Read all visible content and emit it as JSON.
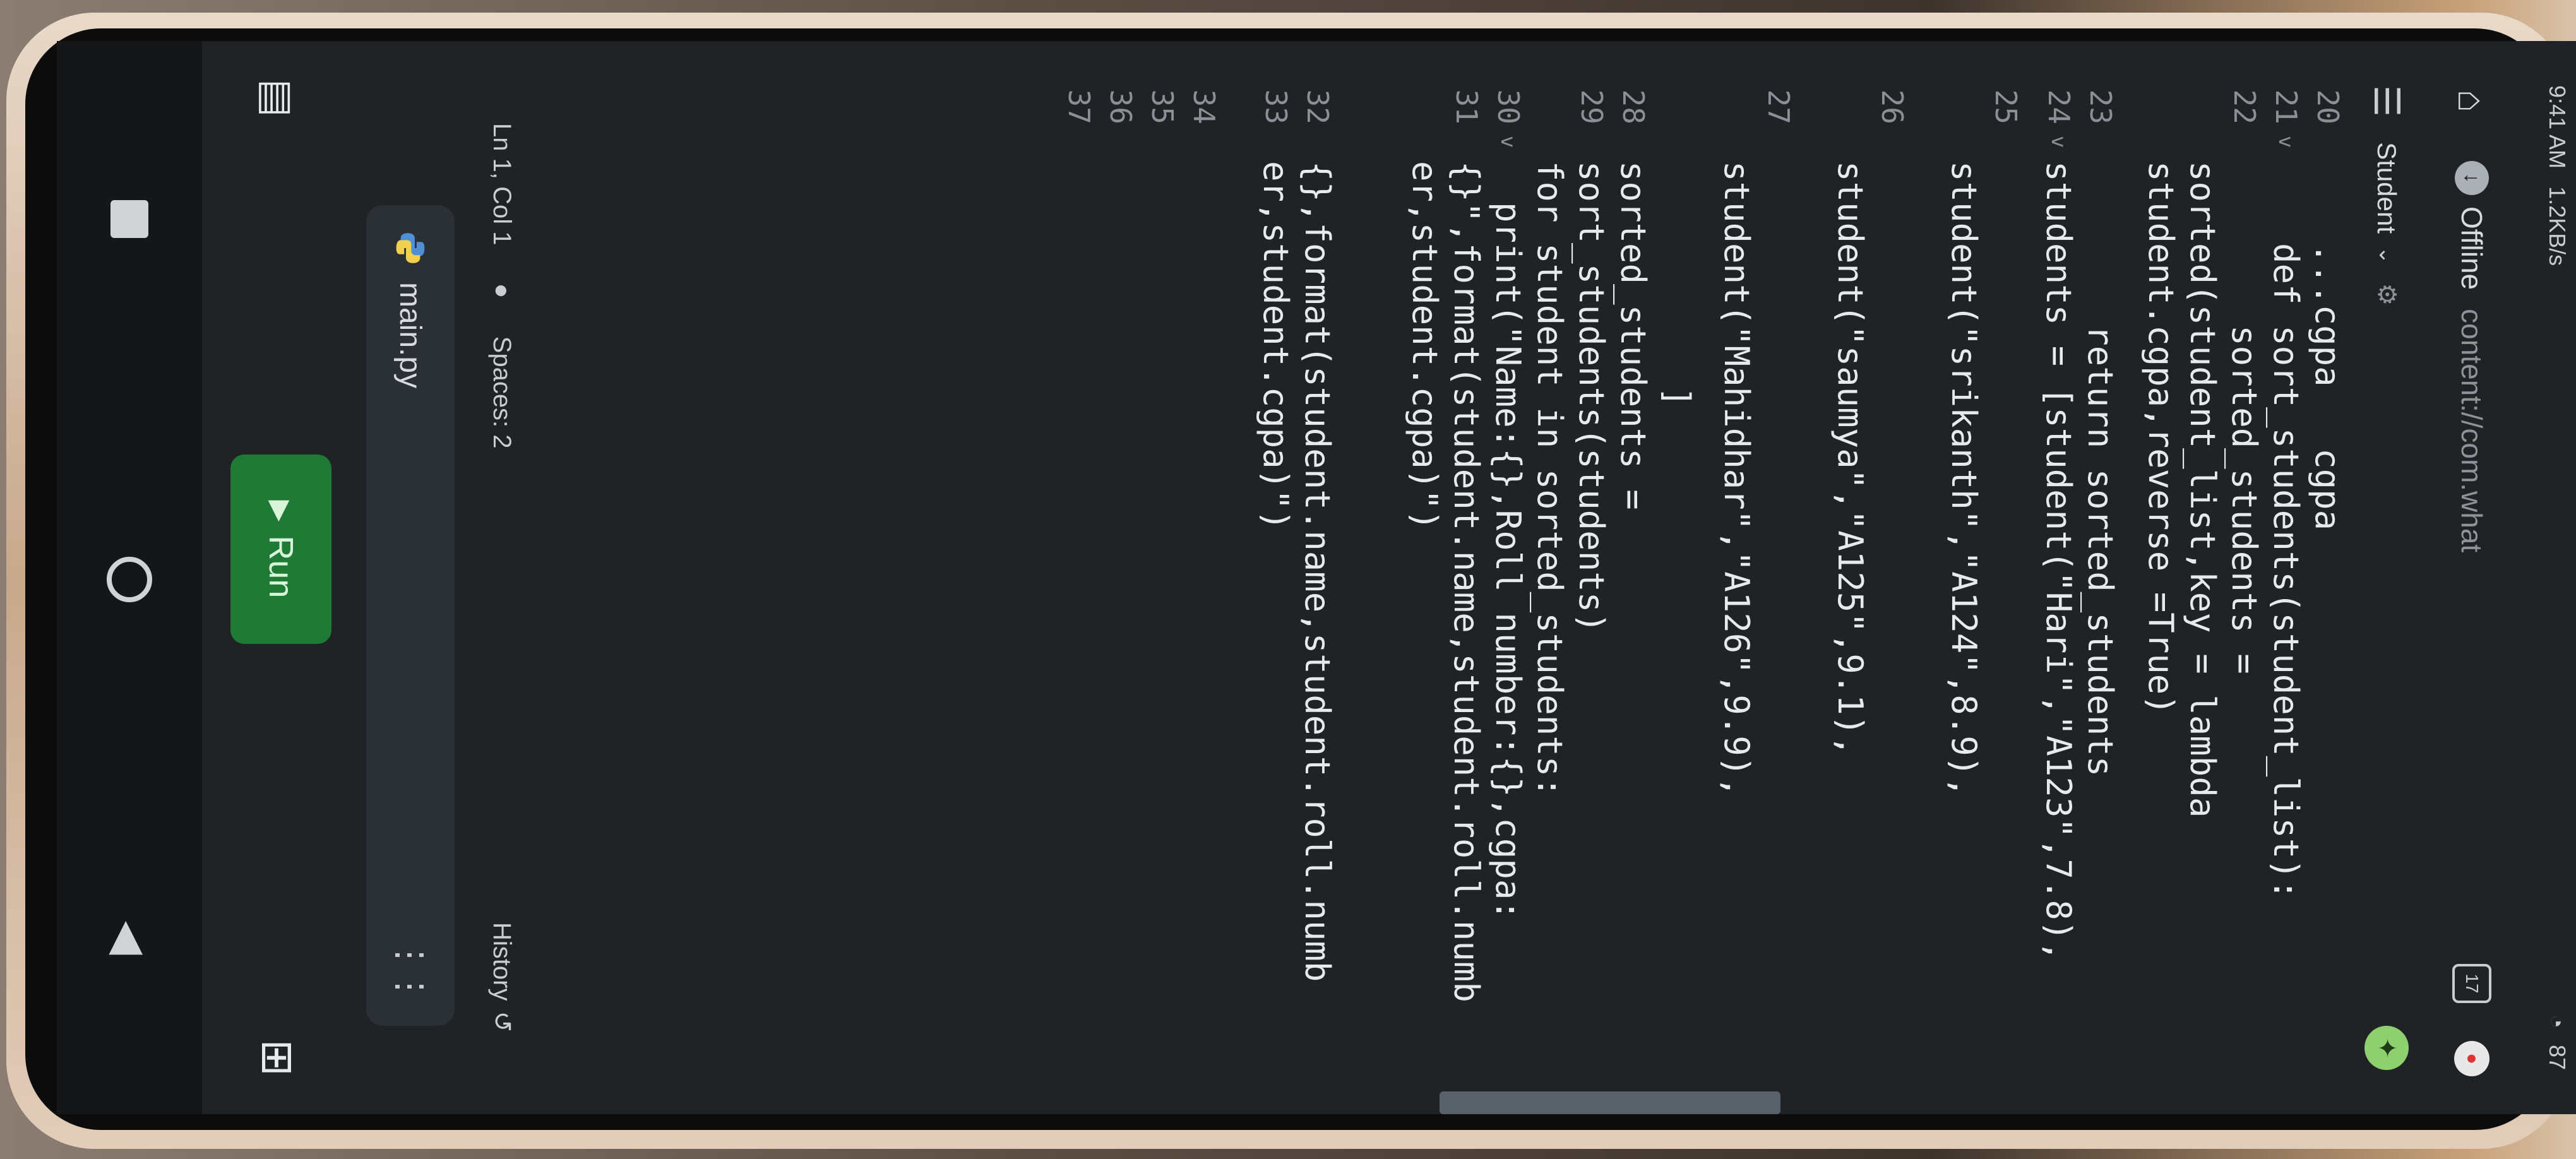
{
  "status_bar": {
    "time": "9:41 AM",
    "network_speed": "1.2KB/s",
    "battery": "87"
  },
  "browser": {
    "offline_label": "Offline",
    "url": "content://com.what",
    "tab_count": "17"
  },
  "editor": {
    "file_title": "Student",
    "lines": [
      {
        "num": "20",
        "fold": "",
        "text": "    ...cgpa   cgpa"
      },
      {
        "num": "21",
        "fold": "v",
        "text": "    def sort_students(student_list):"
      },
      {
        "num": "22",
        "fold": "",
        "text": "        sorted_students ="
      },
      {
        "num": "",
        "fold": "",
        "text": "sorted(student_list,key = lambda"
      },
      {
        "num": "",
        "fold": "",
        "text": "student.cgpa,reverse =True)"
      },
      {
        "num": "23",
        "fold": "",
        "text": "        return sorted_students"
      },
      {
        "num": "24",
        "fold": "v",
        "text": "students = [student(\"Hari\",\"A123\",7.8),"
      },
      {
        "num": "25",
        "fold": "",
        "text": ""
      },
      {
        "num": "",
        "fold": "",
        "text": "student(\"srikanth\",\"A124\",8.9),"
      },
      {
        "num": "26",
        "fold": "",
        "text": ""
      },
      {
        "num": "",
        "fold": "",
        "text": "student(\"saumya\",\"A125\",9.1),"
      },
      {
        "num": "27",
        "fold": "",
        "text": ""
      },
      {
        "num": "",
        "fold": "",
        "text": "student(\"Mahidhar\",\"A126\",9.9),"
      },
      {
        "num": "",
        "fold": "",
        "text": "           ]"
      },
      {
        "num": "28",
        "fold": "",
        "text": "sorted_students ="
      },
      {
        "num": "29",
        "fold": "",
        "text": "sort_students(students)"
      },
      {
        "num": "",
        "fold": "",
        "text": "for student in sorted_students:"
      },
      {
        "num": "30",
        "fold": "v",
        "text": "  print(\"Name:{},Roll number:{},cgpa:"
      },
      {
        "num": "31",
        "fold": "",
        "text": "{}\",format(student.name,student.roll.numb"
      },
      {
        "num": "",
        "fold": "",
        "text": "er,student.cgpa)\")"
      },
      {
        "num": "",
        "fold": "",
        "text": ""
      },
      {
        "num": "32",
        "fold": "",
        "text": "{},format(student.name,student.roll.numb"
      },
      {
        "num": "33",
        "fold": "",
        "text": "er,student.cgpa)\")"
      },
      {
        "num": "34",
        "fold": "",
        "text": ""
      },
      {
        "num": "35",
        "fold": "",
        "text": ""
      },
      {
        "num": "36",
        "fold": "",
        "text": ""
      },
      {
        "num": "37",
        "fold": "",
        "text": ""
      }
    ]
  },
  "editor_status": {
    "cursor": "Ln 1, Col 1",
    "spaces": "Spaces: 2",
    "history": "History"
  },
  "file_bar": {
    "file_name": "main.py"
  },
  "run_bar": {
    "run_label": "Run"
  },
  "icons": {
    "home": "home-icon",
    "tabs": "tabs-icon",
    "menu": "menu-icon",
    "sidebar": "sidebar-icon",
    "grid": "grid-icon",
    "history": "history-icon",
    "python": "python-file-icon"
  },
  "colors": {
    "run_button": "#1f7a35",
    "editor_background": "#202326"
  }
}
